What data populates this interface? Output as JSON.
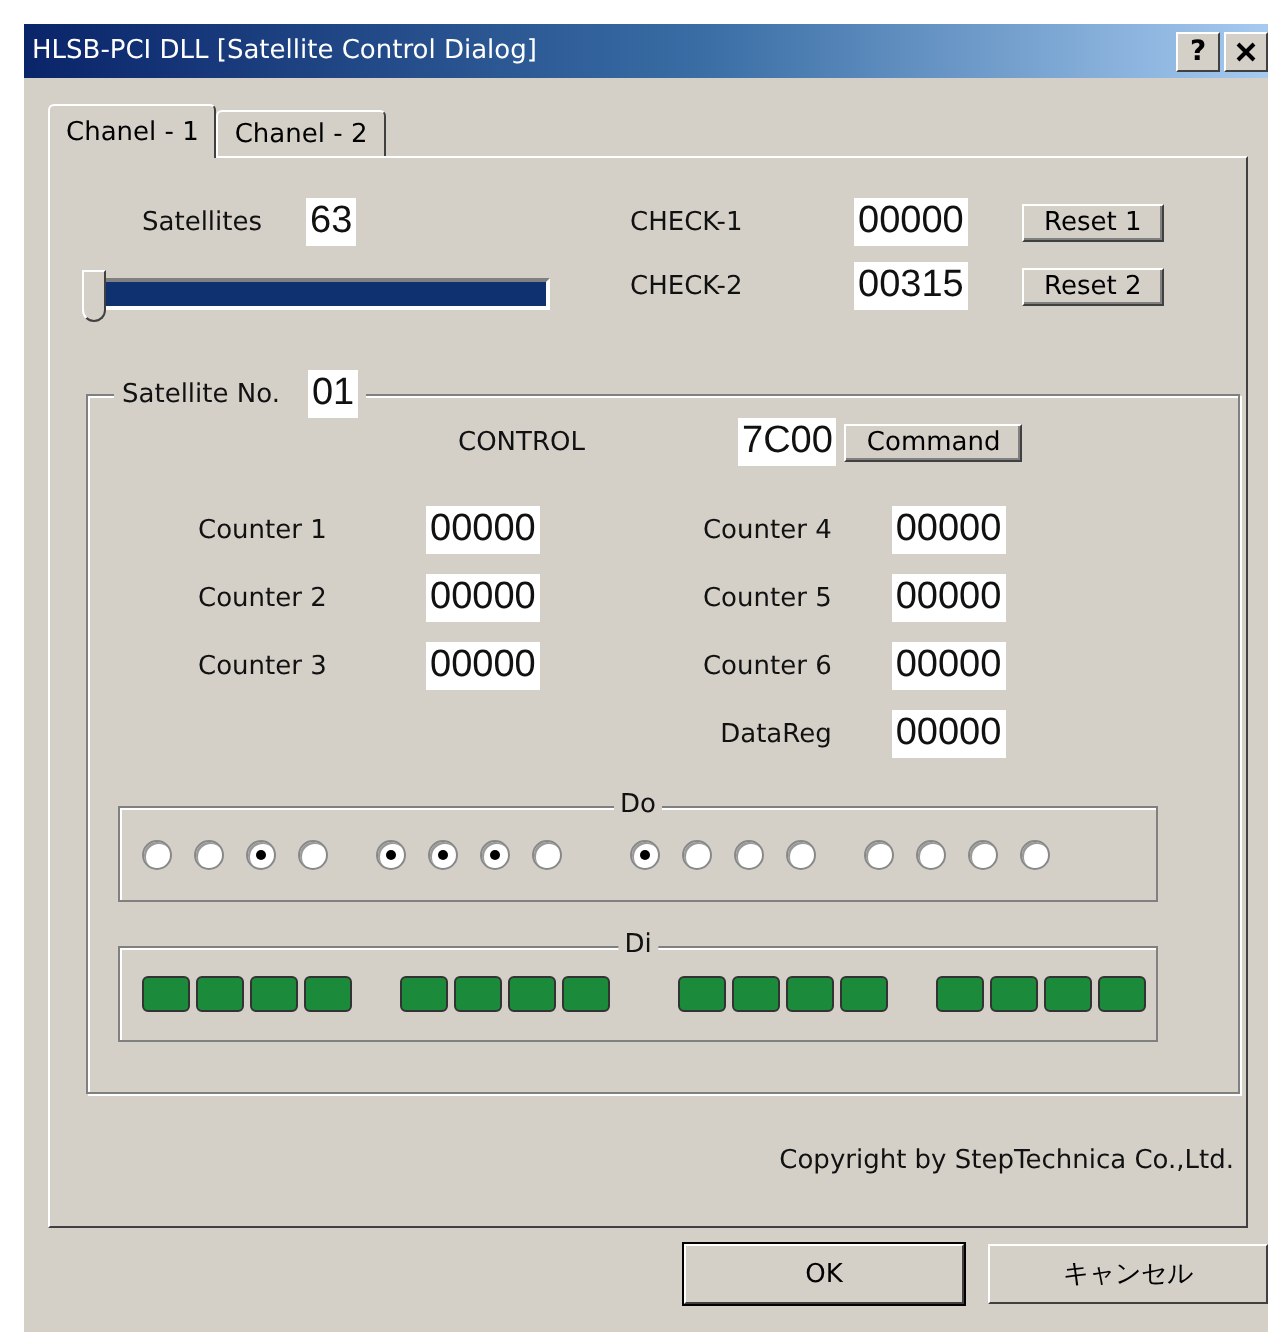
{
  "window": {
    "title": "HLSB-PCI DLL [Satellite Control Dialog]",
    "help": "?"
  },
  "tabs": [
    {
      "label": "Chanel - 1",
      "selected": true
    },
    {
      "label": "Chanel - 2",
      "selected": false
    }
  ],
  "satellites": {
    "label": "Satellites",
    "value": "63",
    "level": 0
  },
  "checks": [
    {
      "label": "CHECK-1",
      "value": "00000",
      "button": "Reset 1"
    },
    {
      "label": "CHECK-2",
      "value": "00315",
      "button": "Reset 2"
    }
  ],
  "satellite_group": {
    "label": "Satellite No.",
    "value": "01",
    "control": {
      "label": "CONTROL",
      "value": "7C00",
      "button": "Command"
    },
    "counters_left": [
      {
        "label": "Counter 1",
        "value": "00000"
      },
      {
        "label": "Counter 2",
        "value": "00000"
      },
      {
        "label": "Counter 3",
        "value": "00000"
      }
    ],
    "counters_right": [
      {
        "label": "Counter 4",
        "value": "00000"
      },
      {
        "label": "Counter 5",
        "value": "00000"
      },
      {
        "label": "Counter 6",
        "value": "00000"
      },
      {
        "label": "DataReg",
        "value": "00000"
      }
    ],
    "do": {
      "label": "Do",
      "groups": [
        [
          {
            "checked": false
          },
          {
            "checked": false
          },
          {
            "checked": true
          },
          {
            "checked": false
          }
        ],
        [
          {
            "checked": true
          },
          {
            "checked": true
          },
          {
            "checked": true
          },
          {
            "checked": false
          }
        ],
        [
          {
            "checked": true
          },
          {
            "checked": false
          },
          {
            "checked": false
          },
          {
            "checked": false
          }
        ],
        [
          {
            "checked": false
          },
          {
            "checked": false
          },
          {
            "checked": false
          },
          {
            "checked": false
          }
        ]
      ]
    },
    "di": {
      "label": "Di",
      "groups": [
        [
          {
            "on": true
          },
          {
            "on": true
          },
          {
            "on": true
          },
          {
            "on": true
          }
        ],
        [
          {
            "on": true
          },
          {
            "on": true
          },
          {
            "on": true
          },
          {
            "on": true
          }
        ],
        [
          {
            "on": true
          },
          {
            "on": true
          },
          {
            "on": true
          },
          {
            "on": true
          }
        ],
        [
          {
            "on": true
          },
          {
            "on": true
          },
          {
            "on": true
          },
          {
            "on": true
          }
        ]
      ]
    }
  },
  "copyright": "Copyright by StepTechnica Co.,Ltd.",
  "buttons": [
    {
      "label": "OK",
      "default": true
    },
    {
      "label": "キャンセル",
      "default": false
    }
  ]
}
